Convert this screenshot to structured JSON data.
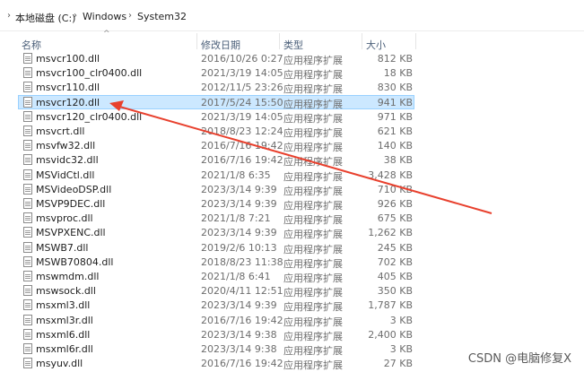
{
  "breadcrumb": {
    "items": [
      "本地磁盘 (C:)",
      "Windows",
      "System32"
    ]
  },
  "columns": {
    "name": "名称",
    "date": "修改日期",
    "type": "类型",
    "size": "大小"
  },
  "files": [
    {
      "name": "msvcr100.dll",
      "date": "2016/10/26 0:27",
      "type": "应用程序扩展",
      "size": "812 KB"
    },
    {
      "name": "msvcr100_clr0400.dll",
      "date": "2021/3/19 14:05",
      "type": "应用程序扩展",
      "size": "18 KB"
    },
    {
      "name": "msvcr110.dll",
      "date": "2012/11/5 23:26",
      "type": "应用程序扩展",
      "size": "830 KB"
    },
    {
      "name": "msvcr120.dll",
      "date": "2017/5/24 15:50",
      "type": "应用程序扩展",
      "size": "941 KB",
      "selected": true
    },
    {
      "name": "msvcr120_clr0400.dll",
      "date": "2021/3/19 14:05",
      "type": "应用程序扩展",
      "size": "971 KB"
    },
    {
      "name": "msvcrt.dll",
      "date": "2018/8/23 12:24",
      "type": "应用程序扩展",
      "size": "621 KB"
    },
    {
      "name": "msvfw32.dll",
      "date": "2016/7/16 19:42",
      "type": "应用程序扩展",
      "size": "140 KB"
    },
    {
      "name": "msvidc32.dll",
      "date": "2016/7/16 19:42",
      "type": "应用程序扩展",
      "size": "38 KB"
    },
    {
      "name": "MSVidCtl.dll",
      "date": "2021/1/8 6:35",
      "type": "应用程序扩展",
      "size": "3,428 KB"
    },
    {
      "name": "MSVideoDSP.dll",
      "date": "2023/3/14 9:39",
      "type": "应用程序扩展",
      "size": "710 KB"
    },
    {
      "name": "MSVP9DEC.dll",
      "date": "2023/3/14 9:39",
      "type": "应用程序扩展",
      "size": "926 KB"
    },
    {
      "name": "msvproc.dll",
      "date": "2021/1/8 7:21",
      "type": "应用程序扩展",
      "size": "675 KB"
    },
    {
      "name": "MSVPXENC.dll",
      "date": "2023/3/14 9:39",
      "type": "应用程序扩展",
      "size": "1,262 KB"
    },
    {
      "name": "MSWB7.dll",
      "date": "2019/2/6 10:13",
      "type": "应用程序扩展",
      "size": "245 KB"
    },
    {
      "name": "MSWB70804.dll",
      "date": "2018/8/23 11:38",
      "type": "应用程序扩展",
      "size": "702 KB"
    },
    {
      "name": "mswmdm.dll",
      "date": "2021/1/8 6:41",
      "type": "应用程序扩展",
      "size": "405 KB"
    },
    {
      "name": "mswsock.dll",
      "date": "2020/4/11 12:51",
      "type": "应用程序扩展",
      "size": "350 KB"
    },
    {
      "name": "msxml3.dll",
      "date": "2023/3/14 9:39",
      "type": "应用程序扩展",
      "size": "1,787 KB"
    },
    {
      "name": "msxml3r.dll",
      "date": "2016/7/16 19:42",
      "type": "应用程序扩展",
      "size": "3 KB"
    },
    {
      "name": "msxml6.dll",
      "date": "2023/3/14 9:38",
      "type": "应用程序扩展",
      "size": "2,400 KB"
    },
    {
      "name": "msxml6r.dll",
      "date": "2023/3/14 9:38",
      "type": "应用程序扩展",
      "size": "3 KB"
    },
    {
      "name": "msyuv.dll",
      "date": "2016/7/16 19:42",
      "type": "应用程序扩展",
      "size": "27 KB"
    }
  ],
  "watermark": "CSDN @电脑修复X",
  "colors": {
    "selection": "#cce8ff",
    "annotation_arrow": "#e8402d"
  }
}
